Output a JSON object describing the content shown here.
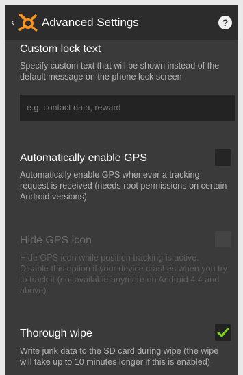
{
  "header": {
    "title": "Advanced Settings",
    "help": "?",
    "back": "‹"
  },
  "settings": [
    {
      "title": "Custom lock text",
      "description": "Specify custom text that will be shown instead of the default message on the phone lock screen",
      "input_placeholder": "e.g. contact data, reward",
      "input_value": ""
    },
    {
      "title": "Automatically enable GPS",
      "description": "Automatically enable GPS whenever a tracking request is received (needs root permissions on certain Android versions)",
      "checked": false,
      "enabled": true
    },
    {
      "title": "Hide GPS icon",
      "description": "Hide GPS icon while position tracking is active. Disable this option if your device crashes when you try to track it (not available anymore on Android 4.4 and above)",
      "checked": false,
      "enabled": false
    },
    {
      "title": "Thorough wipe",
      "description": "Write junk data to the SD card during wipe (the wipe will take up to 10 minutes longer if this is enabled)",
      "checked": true,
      "enabled": true
    }
  ],
  "colors": {
    "accent_check": "#7ed321",
    "logo_orange": "#f7931e",
    "background": "#3a3a3a",
    "actionbar": "#2c2c2c"
  }
}
